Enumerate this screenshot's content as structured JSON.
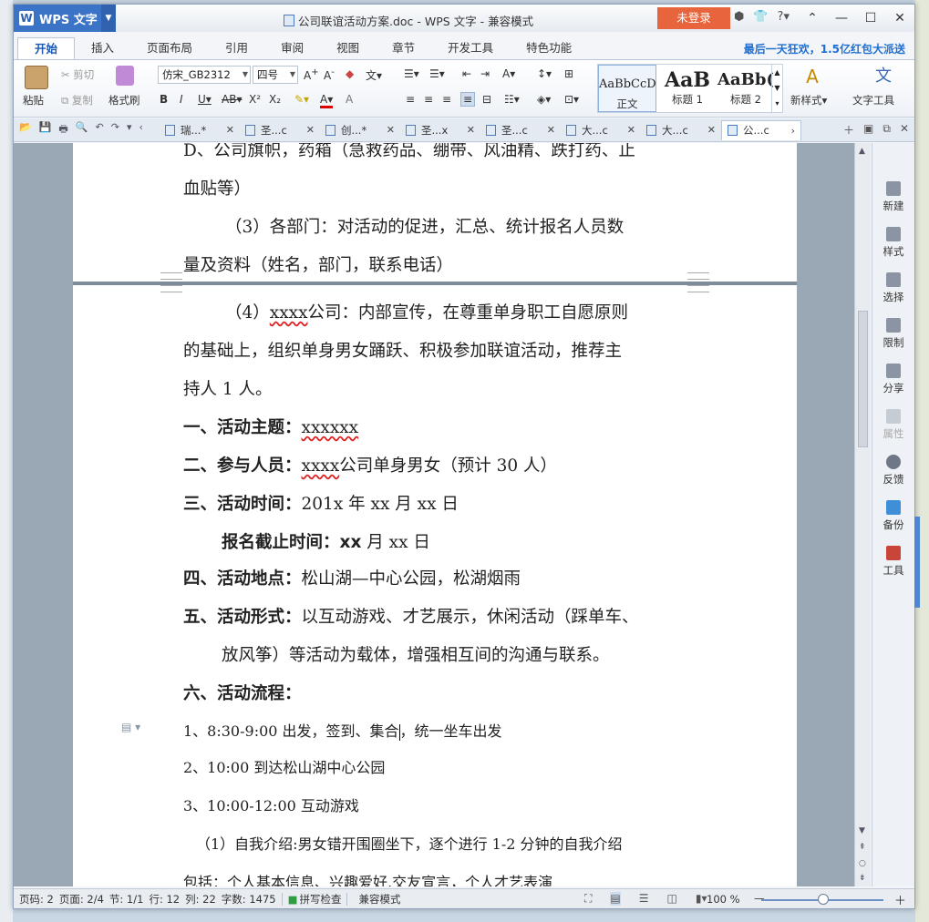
{
  "app": {
    "name": "WPS 文字",
    "doc_title": "公司联谊活动方案.doc - WPS 文字 - 兼容模式",
    "login_label": "未登录"
  },
  "menu_tabs": [
    "开始",
    "插入",
    "页面布局",
    "引用",
    "审阅",
    "视图",
    "章节",
    "开发工具",
    "特色功能"
  ],
  "promo": "最后一天狂欢，1.5亿红包大派送",
  "ribbon": {
    "paste": "粘贴",
    "cut": "剪切",
    "copy": "复制",
    "format_painter": "格式刷",
    "font_name": "仿宋_GB2312",
    "font_size": "四号",
    "styles": [
      {
        "preview": "AaBbCcD",
        "label": "正文"
      },
      {
        "preview": "AaB",
        "label": "标题 1"
      },
      {
        "preview": "AaBb(",
        "label": "标题 2"
      }
    ],
    "new_style": "新样式",
    "text_tools": "文字工具"
  },
  "doc_tabs": [
    "瑞...*",
    "圣...c",
    "创...*",
    "圣...x",
    "圣...c",
    "大...c",
    "大...c",
    "公...c"
  ],
  "document": {
    "p1_line1": "D、公司旗帜，药箱（急救药品、绷带、风油精、跌打药、止",
    "p1_line2": "血贴等）",
    "p1_line3": "（3）各部门：对活动的促进，汇总、统计报名人员数",
    "p1_line4": "量及资料（姓名，部门，联系电话）",
    "p2_l1_pre": "（4）",
    "p2_l1_red": "xxxx",
    "p2_l1_post": "公司：内部宣传，在尊重单身职工自愿原则",
    "p2_l2": "的基础上，组织单身男女踊跃、积极参加联谊活动，推荐主",
    "p2_l3": "持人 1 人。",
    "theme_label": "一、活动主题：",
    "theme_val": "xxxxxx",
    "people_label": "二、参与人员：",
    "people_red": "xxxx",
    "people_post": "公司单身男女（预计 30 人）",
    "time_label": "三、活动时间：",
    "time_val": "201x 年 xx 月  xx 日",
    "deadline_label": "报名截止时间：",
    "deadline_val": "xx",
    "deadline_post": "月 xx 日",
    "place_label": "四、活动地点：",
    "place_val": "松山湖—中心公园，松湖烟雨",
    "form_label": "五、活动形式：",
    "form_val1": "以互动游戏、才艺展示，休闲活动（踩单车、",
    "form_val2": "放风筝）等活动为载体，增强相互间的沟通与联系。",
    "flow_label": "六、活动流程：",
    "flow1_pre": "1、8:30-9:00  出发，签到、集合",
    "flow1_post": "，统一坐车出发",
    "flow2": "2、10:00 到达松山湖中心公园",
    "flow3": "3、10:00-12:00 互动游戏",
    "flow4": "（1）自我介绍:男女错开围圈坐下，逐个进行 1-2 分钟的自我介绍",
    "flow5": "包括：个人基本信息、兴趣爱好,交友宣言，个人才艺表演"
  },
  "side_panel": [
    "新建",
    "样式",
    "选择",
    "限制",
    "分享",
    "属性",
    "反馈",
    "备份",
    "工具"
  ],
  "status": {
    "page_code": "页码: 2",
    "pages": "页面: 2/4",
    "section": "节: 1/1",
    "row": "行: 12",
    "col": "列: 22",
    "words": "字数: 1475",
    "spell": "拼写检查",
    "compat": "兼容模式",
    "zoom": "100 %"
  }
}
